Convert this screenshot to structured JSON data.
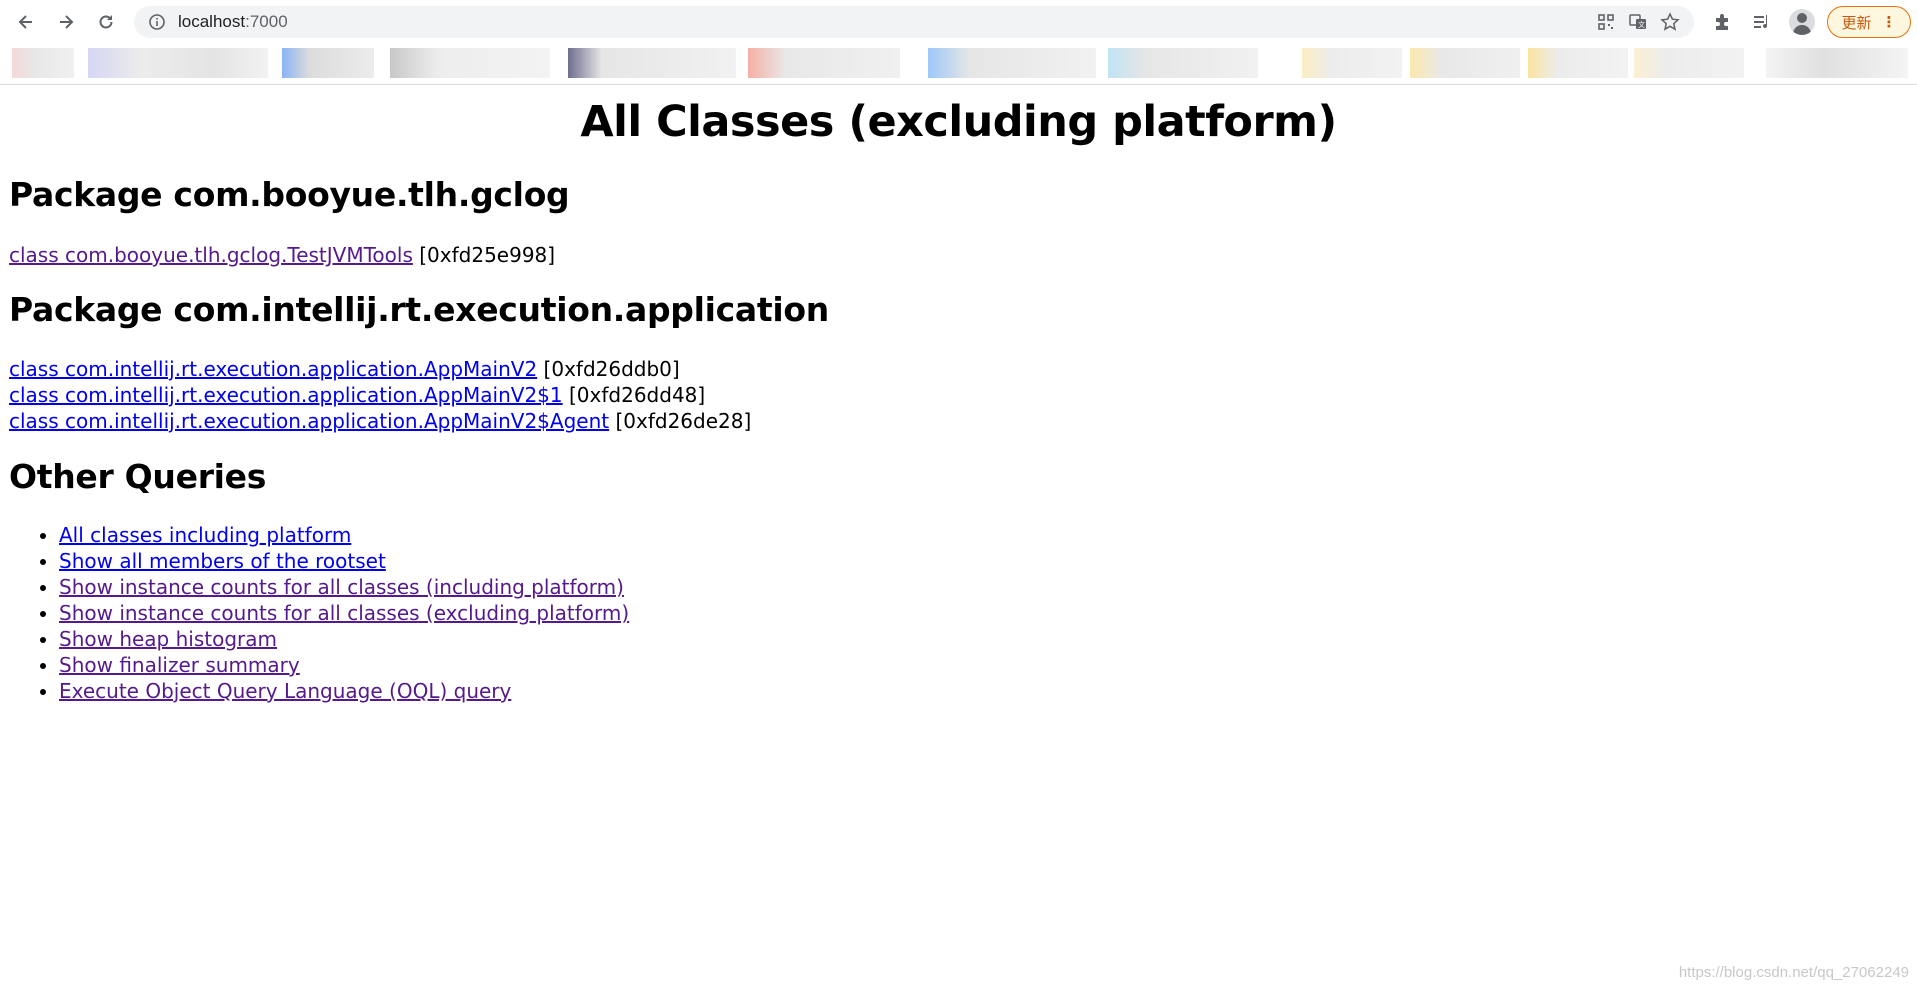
{
  "browser": {
    "url_host": "localhost",
    "url_port": ":7000",
    "update_label": "更新"
  },
  "page": {
    "title": "All Classes (excluding platform)",
    "packages": [
      {
        "heading": "Package com.booyue.tlh.gclog",
        "classes": [
          {
            "link": "class com.booyue.tlh.gclog.TestJVMTools",
            "address": "[0xfd25e998]"
          }
        ]
      },
      {
        "heading": "Package com.intellij.rt.execution.application",
        "classes": [
          {
            "link": "class com.intellij.rt.execution.application.AppMainV2",
            "address": "[0xfd26ddb0]"
          },
          {
            "link": "class com.intellij.rt.execution.application.AppMainV2$1",
            "address": "[0xfd26dd48]"
          },
          {
            "link": "class com.intellij.rt.execution.application.AppMainV2$Agent",
            "address": "[0xfd26de28]"
          }
        ]
      }
    ],
    "other_heading": "Other Queries",
    "queries": [
      "All classes including platform",
      "Show all members of the rootset",
      "Show instance counts for all classes (including platform)",
      "Show instance counts for all classes (excluding platform)",
      "Show heap histogram",
      "Show finalizer summary",
      "Execute Object Query Language (OQL) query"
    ]
  },
  "watermark": "https://blog.csdn.net/qq_27062249",
  "colors": {
    "link": "#0000ee",
    "visited": "#551a8b",
    "update_accent": "#e8710a"
  }
}
